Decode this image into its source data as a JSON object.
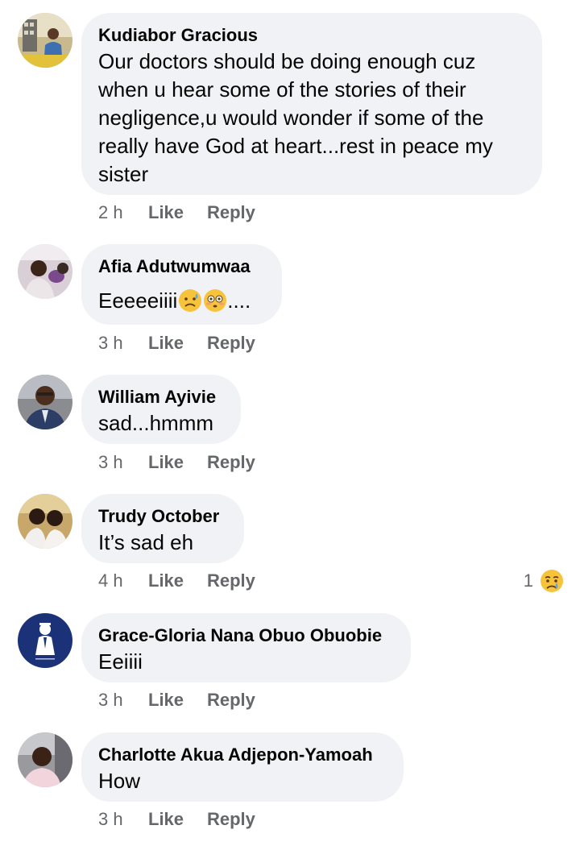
{
  "comments": [
    {
      "name": "Kudiabor Gracious",
      "text": "Our doctors should be doing enough cuz when u hear some of the stories of their negligence,u would wonder if some of the really have God at heart...rest in peace my sister",
      "time": "2 h",
      "like": "Like",
      "reply": "Reply",
      "avatar_icon": "person-photo-icon"
    },
    {
      "name": "Afia Adutwumwaa",
      "text": "Eeeeeiiii",
      "text_suffix": "....",
      "emojis": [
        "sad-sweat-face-emoji",
        "flushed-face-emoji"
      ],
      "time": "3 h",
      "like": "Like",
      "reply": "Reply",
      "avatar_icon": "person-photo-icon"
    },
    {
      "name": "William Ayivie",
      "text": "sad...hmmm",
      "time": "3 h",
      "like": "Like",
      "reply": "Reply",
      "avatar_icon": "person-photo-icon"
    },
    {
      "name": "Trudy October",
      "text": "It’s sad eh",
      "time": "4 h",
      "like": "Like",
      "reply": "Reply",
      "reaction_count": "1",
      "reaction_icon": "sad-reaction-icon",
      "avatar_icon": "person-photo-icon"
    },
    {
      "name": "Grace-Gloria Nana Obuo Obuobie",
      "text": "Eeiiii",
      "time": "3 h",
      "like": "Like",
      "reply": "Reply",
      "avatar_icon": "suited-figure-logo-icon"
    },
    {
      "name": "Charlotte Akua Adjepon-Yamoah",
      "text": "How",
      "time": "3 h",
      "like": "Like",
      "reply": "Reply",
      "avatar_icon": "person-photo-icon"
    }
  ],
  "colors": {
    "bubble": "#f0f2f5",
    "meta_text": "#65676b",
    "primary_text": "#050505"
  }
}
